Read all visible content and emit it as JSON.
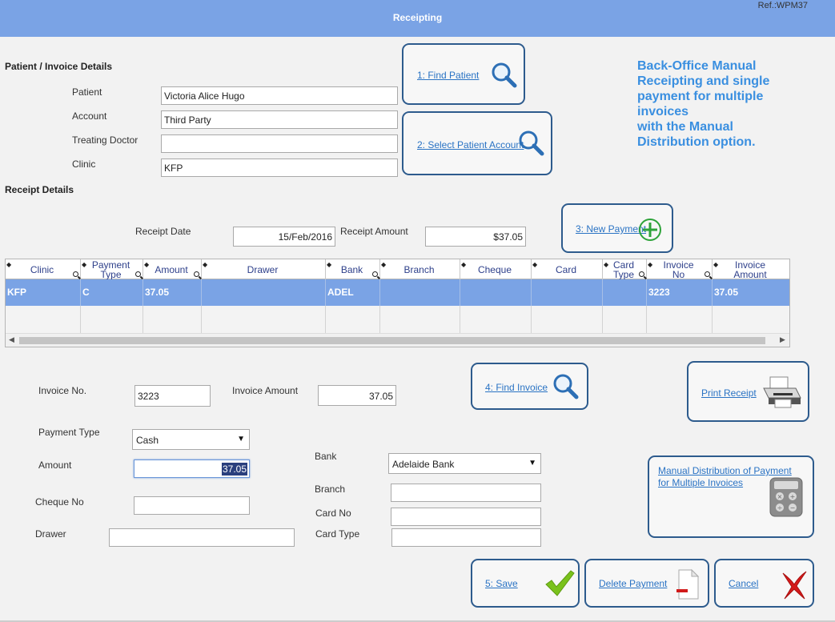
{
  "header": {
    "title": "Receipting",
    "ref": "Ref.:WPM37",
    "color": "#7aa3e5"
  },
  "patient_section": {
    "title": "Patient / Invoice Details",
    "fields": [
      {
        "label": "Patient",
        "value": "Victoria Alice Hugo"
      },
      {
        "label": "Account",
        "value": "Third Party"
      },
      {
        "label": "Treating Doctor",
        "value": ""
      },
      {
        "label": "Clinic",
        "value": "KFP"
      }
    ]
  },
  "actions": {
    "find_patient": "1: Find Patient",
    "select_account": "2: Select Patient Account",
    "new_payment": "3: New Payment",
    "find_invoice": "4: Find Invoice",
    "print_receipt": "Print Receipt",
    "manual_distribution_line1": "Manual Distribution of Payment",
    "manual_distribution_line2": "for Multiple Invoices",
    "save": "5: Save",
    "delete_payment": "Delete Payment",
    "cancel": "Cancel"
  },
  "banner": {
    "line1": "Back-Office Manual",
    "line2": "Receipting and single",
    "line3": "payment for multiple",
    "line4": "invoices",
    "line5": "with the Manual",
    "line6": "Distribution option."
  },
  "receipt_section": {
    "title": "Receipt Details",
    "date_label": "Receipt Date",
    "date_value": "15/Feb/2016",
    "amount_label": "Receipt Amount",
    "amount_value": "$37.05"
  },
  "grid": {
    "columns": [
      {
        "line1": "Clinic",
        "line2": ""
      },
      {
        "line1": "Payment",
        "line2": "Type"
      },
      {
        "line1": "Amount",
        "line2": ""
      },
      {
        "line1": "Drawer",
        "line2": ""
      },
      {
        "line1": "Bank",
        "line2": ""
      },
      {
        "line1": "Branch",
        "line2": ""
      },
      {
        "line1": "Cheque",
        "line2": ""
      },
      {
        "line1": "Card",
        "line2": ""
      },
      {
        "line1": "Card",
        "line2": "Type"
      },
      {
        "line1": "Invoice",
        "line2": "No"
      },
      {
        "line1": "Invoice",
        "line2": "Amount"
      }
    ],
    "rows": [
      [
        "KFP",
        "C",
        "37.05",
        "",
        "ADEL",
        "",
        "",
        "",
        "",
        "3223",
        "37.05"
      ]
    ]
  },
  "invoice_form": {
    "invoice_no_label": "Invoice No.",
    "invoice_no_value": "3223",
    "invoice_amount_label": "Invoice Amount",
    "invoice_amount_value": "37.05",
    "payment_type_label": "Payment Type",
    "payment_type_value": "Cash",
    "amount_label": "Amount",
    "amount_value": "37.05",
    "cheque_no_label": "Cheque No",
    "cheque_no_value": "",
    "drawer_label": "Drawer",
    "drawer_value": "",
    "bank_label": "Bank",
    "bank_value": "Adelaide Bank",
    "branch_label": "Branch",
    "branch_value": "",
    "card_no_label": "Card No",
    "card_no_value": "",
    "card_type_label": "Card Type",
    "card_type_value": ""
  }
}
